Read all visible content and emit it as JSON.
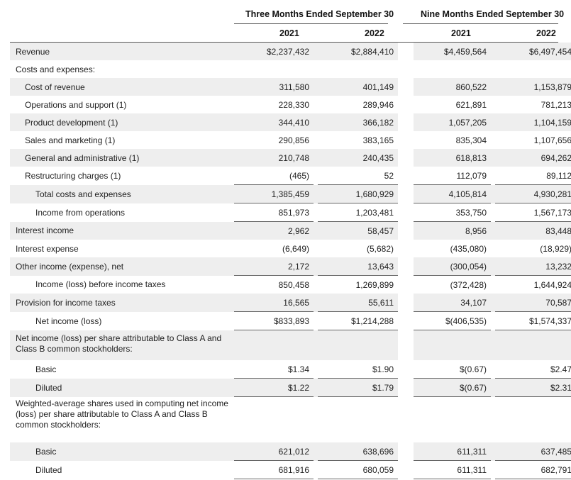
{
  "header": {
    "period_three": "Three Months Ended September 30",
    "period_nine": "Nine Months Ended September 30",
    "years": [
      "2021",
      "2022",
      "2021",
      "2022"
    ]
  },
  "rows": [
    {
      "label": "Revenue",
      "values": [
        "$2,237,432",
        "$2,884,410",
        "$4,459,564",
        "$6,497,454"
      ]
    },
    {
      "label": "Costs and expenses:",
      "values": [
        "",
        "",
        "",
        ""
      ]
    },
    {
      "label": "Cost of revenue",
      "values": [
        "311,580",
        "401,149",
        "860,522",
        "1,153,879"
      ]
    },
    {
      "label": "Operations and support (1)",
      "values": [
        "228,330",
        "289,946",
        "621,891",
        "781,213"
      ]
    },
    {
      "label": "Product development (1)",
      "values": [
        "344,410",
        "366,182",
        "1,057,205",
        "1,104,159"
      ]
    },
    {
      "label": "Sales and marketing (1)",
      "values": [
        "290,856",
        "383,165",
        "835,304",
        "1,107,656"
      ]
    },
    {
      "label": "General and administrative (1)",
      "values": [
        "210,748",
        "240,435",
        "618,813",
        "694,262"
      ]
    },
    {
      "label": "Restructuring charges (1)",
      "values": [
        "(465)",
        "52",
        "112,079",
        "89,112"
      ]
    },
    {
      "label": "Total costs and expenses",
      "values": [
        "1,385,459",
        "1,680,929",
        "4,105,814",
        "4,930,281"
      ]
    },
    {
      "label": "Income from operations",
      "values": [
        "851,973",
        "1,203,481",
        "353,750",
        "1,567,173"
      ]
    },
    {
      "label": "Interest income",
      "values": [
        "2,962",
        "58,457",
        "8,956",
        "83,448"
      ]
    },
    {
      "label": "Interest expense",
      "values": [
        "(6,649)",
        "(5,682)",
        "(435,080)",
        "(18,929)"
      ]
    },
    {
      "label": "Other income (expense), net",
      "values": [
        "2,172",
        "13,643",
        "(300,054)",
        "13,232"
      ]
    },
    {
      "label": "Income (loss) before income taxes",
      "values": [
        "850,458",
        "1,269,899",
        "(372,428)",
        "1,644,924"
      ]
    },
    {
      "label": "Provision for income taxes",
      "values": [
        "16,565",
        "55,611",
        "34,107",
        "70,587"
      ]
    },
    {
      "label": "Net income (loss)",
      "values": [
        "$833,893",
        "$1,214,288",
        "$(406,535)",
        "$1,574,337"
      ]
    },
    {
      "label": "Net income (loss) per share attributable to Class A and Class B common stockholders:",
      "values": [
        "",
        "",
        "",
        ""
      ]
    },
    {
      "label": "Basic",
      "values": [
        "$1.34",
        "$1.90",
        "$(0.67)",
        "$2.47"
      ]
    },
    {
      "label": "Diluted",
      "values": [
        "$1.22",
        "$1.79",
        "$(0.67)",
        "$2.31"
      ]
    },
    {
      "label": "Weighted-average shares used in computing net income (loss) per share attributable to Class A and Class B common stockholders:",
      "values": [
        "",
        "",
        "",
        ""
      ]
    },
    {
      "label": "Basic",
      "values": [
        "621,012",
        "638,696",
        "611,311",
        "637,485"
      ]
    },
    {
      "label": "Diluted",
      "values": [
        "681,916",
        "680,059",
        "611,311",
        "682,791"
      ]
    }
  ]
}
